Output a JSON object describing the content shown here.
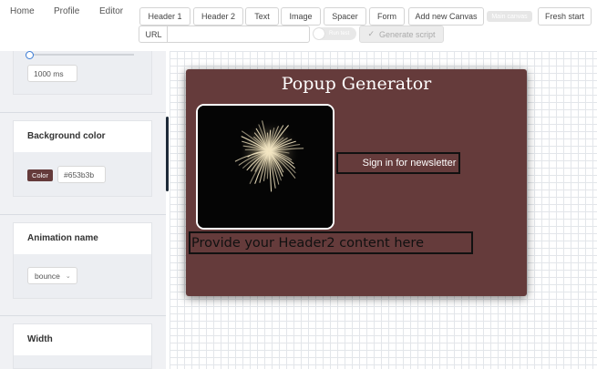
{
  "nav": {
    "home": "Home",
    "profile": "Profile",
    "editor": "Editor"
  },
  "toolbar": {
    "header1": "Header 1",
    "header2": "Header 2",
    "text": "Text",
    "image": "Image",
    "spacer": "Spacer",
    "form": "Form",
    "add_canvas": "Add new Canvas",
    "main_canvas": "Main canvas",
    "fresh_start": "Fresh start",
    "url_label": "URL",
    "url_value": "",
    "run_test": "Run test",
    "generate_script": "Generate script"
  },
  "sidebar": {
    "duration_value": "1000 ms",
    "background_color": {
      "title": "Background color",
      "chip_label": "Color",
      "value": "#653b3b"
    },
    "animation": {
      "title": "Animation name",
      "value": "bounce"
    },
    "width": {
      "title": "Width"
    }
  },
  "popup": {
    "title": "Popup Generator",
    "background": "#653b3b",
    "newsletter_button": "Sign in for newsletter",
    "header2_text": "Provide your Header2 content here",
    "image_icon": "fireworks-image"
  },
  "colors": {
    "canvas_grid": "#e3e6ea",
    "sidebar_bg": "#f0f1f4",
    "accent": "#653b3b"
  }
}
